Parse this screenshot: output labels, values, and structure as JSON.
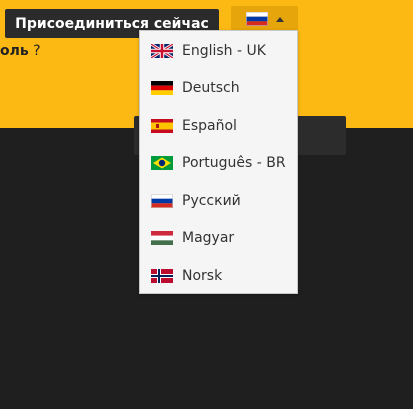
{
  "header": {
    "join_label": "Присоединиться сейчас",
    "password_prompt_bold": "оль",
    "password_prompt_rest": " ?"
  },
  "language_selector": {
    "current_flag_icon": "flag-russia-icon",
    "items": [
      {
        "label": "English - UK",
        "icon": "flag-uk-icon"
      },
      {
        "label": "Deutsch",
        "icon": "flag-germany-icon"
      },
      {
        "label": "Español",
        "icon": "flag-spain-icon"
      },
      {
        "label": "Português - BR",
        "icon": "flag-brazil-icon"
      },
      {
        "label": "Русский",
        "icon": "flag-russia-icon"
      },
      {
        "label": "Magyar",
        "icon": "flag-hungary-icon"
      },
      {
        "label": "Norsk",
        "icon": "flag-norway-icon"
      }
    ]
  },
  "colors": {
    "header_background": "#fdb913",
    "page_background": "#1f1f1f",
    "join_button_background": "#2b2b2b",
    "language_button_background": "#e6a50a"
  }
}
